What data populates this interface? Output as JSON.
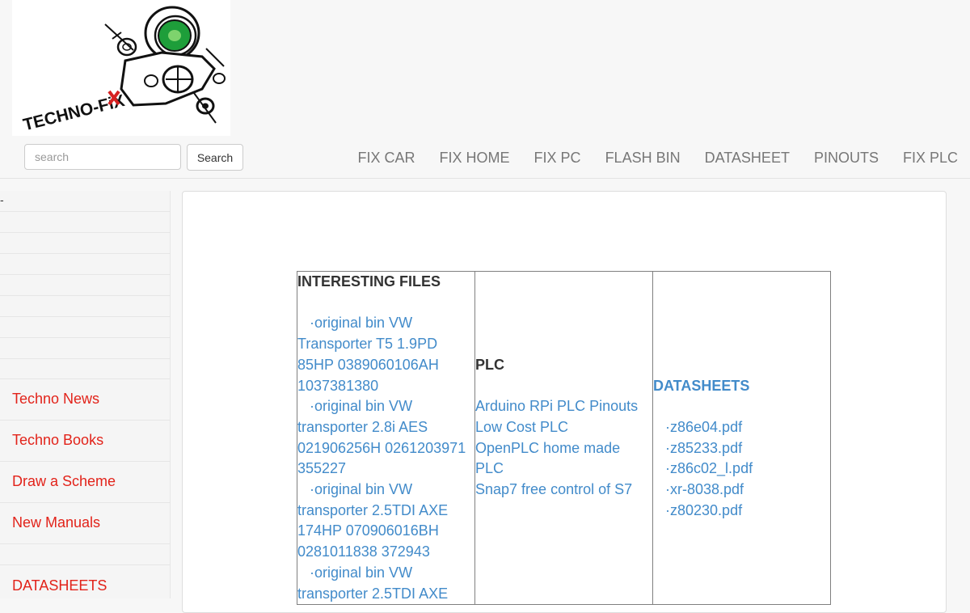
{
  "logo": {
    "text": "TECHNO-FiX"
  },
  "search": {
    "placeholder": "search",
    "button_label": "Search"
  },
  "nav": {
    "items": [
      {
        "label": "FIX CAR"
      },
      {
        "label": "FIX HOME"
      },
      {
        "label": "FIX PC"
      },
      {
        "label": "FLASH BIN"
      },
      {
        "label": "DATASHEET"
      },
      {
        "label": "PINOUTS"
      },
      {
        "label": "FIX PLC"
      }
    ]
  },
  "sidebar": {
    "dash": "-",
    "links": [
      {
        "label": "Techno News"
      },
      {
        "label": "Techno Books"
      },
      {
        "label": "Draw a Scheme"
      },
      {
        "label": "New Manuals"
      }
    ],
    "datasheets_label": "DATASHEETS"
  },
  "table": {
    "col1": {
      "heading": "INTERESTING FILES",
      "items": [
        {
          "bullet": "·",
          "first": "original bin VW",
          "rest": "Transporter T5 1.9PD 85HP 0389060106AH 1037381380"
        },
        {
          "bullet": "·",
          "first": "original bin VW",
          "rest": "transporter 2.8i AES 021906256H 0261203971 355227"
        },
        {
          "bullet": "·",
          "first": "original bin VW",
          "rest": "transporter 2.5TDI AXE 174HP 070906016BH 0281011838 372943"
        },
        {
          "bullet": "·",
          "first": "original bin VW",
          "rest": "transporter 2.5TDI AXE"
        }
      ]
    },
    "col2": {
      "heading": "PLC",
      "items": [
        {
          "label": "Arduino RPi PLC Pinouts"
        },
        {
          "label": "Low Cost PLC"
        },
        {
          "label": "OpenPLC home made PLC"
        },
        {
          "label": "Snap7 free control of S7"
        }
      ]
    },
    "col3": {
      "heading": "DATASHEETS",
      "items": [
        {
          "bullet": "·",
          "label": "z86e04.pdf"
        },
        {
          "bullet": "·",
          "label": "z85233.pdf"
        },
        {
          "bullet": "·",
          "label": "z86c02_l.pdf"
        },
        {
          "bullet": "·",
          "label": "xr-8038.pdf"
        },
        {
          "bullet": "·",
          "label": "z80230.pdf"
        }
      ]
    }
  },
  "colors": {
    "accent_link": "#428bca",
    "sidebar_link": "#e2231a",
    "nav_text": "#777777"
  }
}
